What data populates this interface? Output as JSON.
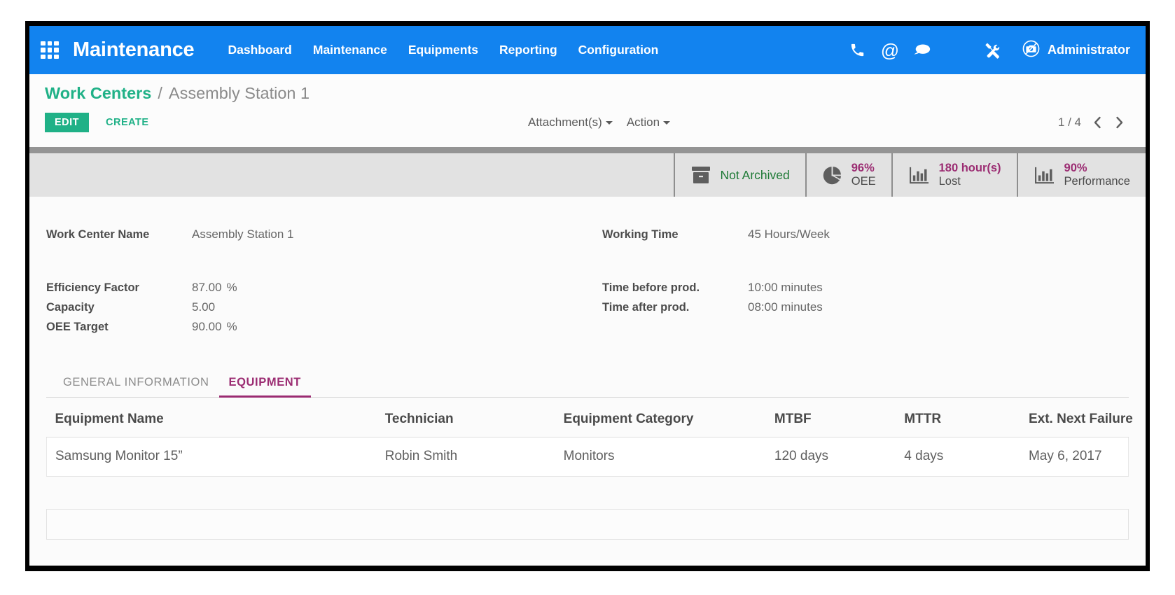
{
  "navbar": {
    "apps_icon": "apps-grid-icon",
    "app_title": "Maintenance",
    "menu_items": [
      {
        "label": "Dashboard"
      },
      {
        "label": "Maintenance"
      },
      {
        "label": "Equipments"
      },
      {
        "label": "Reporting"
      },
      {
        "label": "Configuration"
      }
    ],
    "icons": [
      {
        "name": "phone-icon",
        "glyph": "phone"
      },
      {
        "name": "at-sign-icon",
        "glyph": "@"
      },
      {
        "name": "chat-bubble-icon",
        "glyph": "chat"
      },
      {
        "name": "tools-icon",
        "glyph": "tools"
      }
    ],
    "user": {
      "avatar_icon": "no-camera-avatar-icon",
      "name": "Administrator"
    },
    "background_color": "#1283ef"
  },
  "control_panel": {
    "breadcrumb": {
      "parent": "Work Centers",
      "separator": "/",
      "current": "Assembly Station 1"
    },
    "edit_label": "EDIT",
    "create_label": "CREATE",
    "attachments_label": "Attachment(s)",
    "action_label": "Action",
    "pager": {
      "count": "1 / 4",
      "prev_icon": "chevron-left-icon",
      "next_icon": "chevron-right-icon"
    },
    "accent_color": "#20b187"
  },
  "stat_buttons": [
    {
      "icon": "archive-box-icon",
      "single_line": "Not Archived",
      "value": "",
      "label": "",
      "color": "#1e7a36"
    },
    {
      "icon": "pie-chart-icon",
      "single_line": "",
      "value": "96%",
      "label": "OEE",
      "color": "#9b2c72"
    },
    {
      "icon": "bar-chart-icon",
      "single_line": "",
      "value": "180 hour(s)",
      "label": "Lost",
      "color": "#9b2c72"
    },
    {
      "icon": "bar-chart-icon",
      "single_line": "",
      "value": "90%",
      "label": "Performance",
      "color": "#9b2c72"
    }
  ],
  "form": {
    "left": [
      {
        "label": "Work Center Name",
        "value": "Assembly Station 1",
        "unit": ""
      },
      {
        "label": "Efficiency Factor",
        "value": "87.00",
        "unit": "%"
      },
      {
        "label": "Capacity",
        "value": "5.00",
        "unit": ""
      },
      {
        "label": "OEE Target",
        "value": "90.00",
        "unit": "%"
      }
    ],
    "right": [
      {
        "label": "Working Time",
        "value": "45 Hours/Week",
        "unit": ""
      },
      {
        "label": "Time before prod.",
        "value": "10:00 minutes",
        "unit": ""
      },
      {
        "label": "Time after prod.",
        "value": "08:00 minutes",
        "unit": ""
      }
    ]
  },
  "notebook": {
    "tabs": [
      {
        "label": "GENERAL INFORMATION",
        "active": false
      },
      {
        "label": "EQUIPMENT",
        "active": true
      }
    ],
    "active_color": "#9b2c72"
  },
  "equipment_table": {
    "columns": [
      "Equipment Name",
      "Technician",
      "Equipment Category",
      "MTBF",
      "MTTR",
      "Ext. Next Failure"
    ],
    "rows": [
      {
        "equipment_name": "Samsung Monitor 15”",
        "technician": "Robin Smith",
        "equipment_category": "Monitors",
        "mtbf": "120 days",
        "mttr": "4 days",
        "ext_next_failure": "May 6, 2017"
      }
    ]
  }
}
